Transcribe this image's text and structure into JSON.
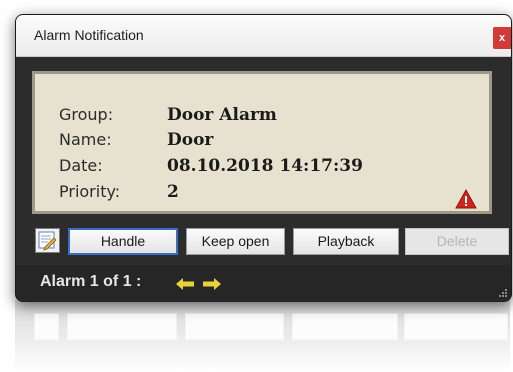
{
  "window": {
    "title": "Alarm Notification",
    "close_label": "x"
  },
  "alarm": {
    "fields": [
      {
        "label": "Group:",
        "value": "Door Alarm"
      },
      {
        "label": "Name:",
        "value": "Door"
      },
      {
        "label": "Date:",
        "value": "08.10.2018 14:17:39"
      },
      {
        "label": "Priority:",
        "value": "2"
      }
    ],
    "priority_icon": "warning-triangle-icon"
  },
  "buttons": {
    "note_icon": "note-edit-icon",
    "handle": "Handle",
    "keep_open": "Keep open",
    "playback": "Playback",
    "delete": "Delete"
  },
  "status": {
    "text": "Alarm 1 of 1 :",
    "prev_icon": "arrow-left-icon",
    "next_icon": "arrow-right-icon"
  },
  "colors": {
    "panel_bg": "#e7e1cf",
    "accent_blue": "#3a6ec4",
    "close_red": "#d23a35",
    "warning_red": "#d0241c",
    "arrow_yellow": "#e8d23a"
  }
}
